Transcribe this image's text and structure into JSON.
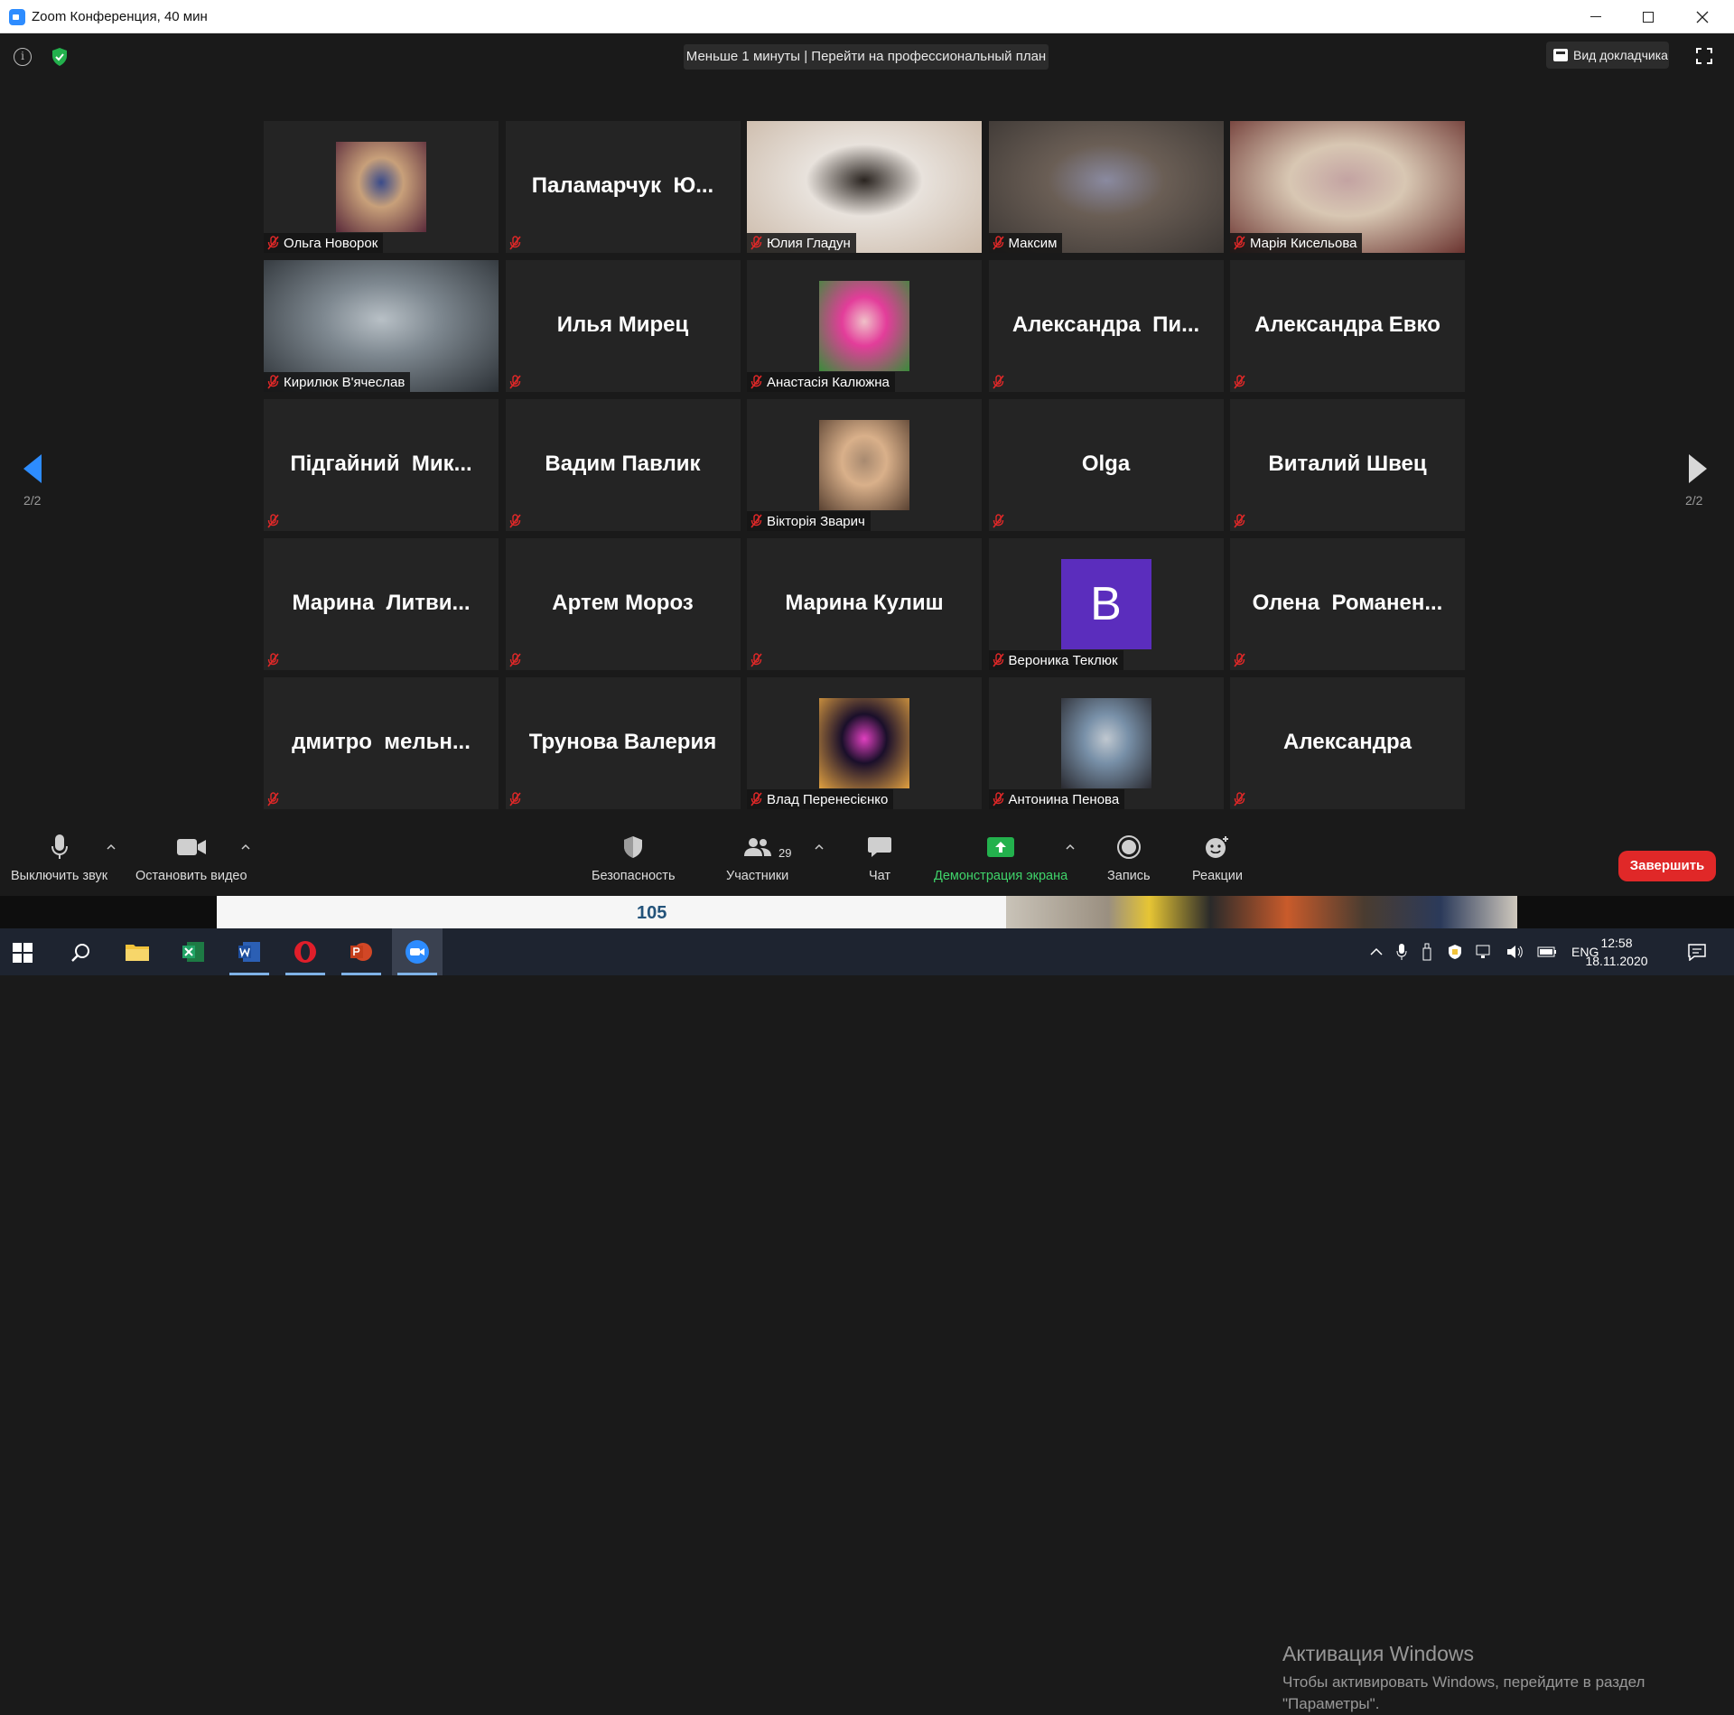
{
  "window": {
    "title": "Zoom Конференция, 40 мин"
  },
  "header": {
    "banner": "Меньше 1 минуты | Перейти на профессиональный план",
    "speaker_view_label": "Вид докладчика"
  },
  "pagination": {
    "left_label": "2/2",
    "right_label": "2/2"
  },
  "participants": [
    {
      "display": "photo",
      "name": "Ольга Новорок",
      "photo_colors": [
        "#c8a07a",
        "#5a2a3a",
        "#3a4b8a"
      ]
    },
    {
      "display": "name",
      "big_name": "Паламарчук  Ю...",
      "name": ""
    },
    {
      "display": "video",
      "name": "Юлия Гладун",
      "photo_colors": [
        "#e8e2dc",
        "#cbb9a8",
        "#2a2420"
      ]
    },
    {
      "display": "video",
      "name": "Максим",
      "photo_colors": [
        "#6a5e55",
        "#3c3734",
        "#8a8aa0"
      ]
    },
    {
      "display": "video",
      "name": "Марія Кисельова",
      "photo_colors": [
        "#d8c7b3",
        "#6b3430",
        "#c3a3a2"
      ]
    },
    {
      "display": "video",
      "name": "Кирилюк В'ячеслав",
      "photo_colors": [
        "#7e8890",
        "#2b3035",
        "#b8c0c6"
      ]
    },
    {
      "display": "name",
      "big_name": "Илья Мирец",
      "name": ""
    },
    {
      "display": "photo",
      "name": "Анастасія Калюжна",
      "photo_colors": [
        "#e33d9a",
        "#3a8c3a",
        "#f0c0c8"
      ]
    },
    {
      "display": "name",
      "big_name": "Александра  Пи...",
      "name": ""
    },
    {
      "display": "name",
      "big_name": "Александра Евко",
      "name": ""
    },
    {
      "display": "name",
      "big_name": "Підгайний  Мик...",
      "name": ""
    },
    {
      "display": "name",
      "big_name": "Вадим Павлик",
      "name": ""
    },
    {
      "display": "photo",
      "name": "Вікторія Зварич",
      "photo_colors": [
        "#d9b08a",
        "#5a4232",
        "#a88a70"
      ]
    },
    {
      "display": "name",
      "big_name": "Olga",
      "name": ""
    },
    {
      "display": "name",
      "big_name": "Виталий Швец",
      "name": ""
    },
    {
      "display": "name",
      "big_name": "Марина  Литви...",
      "name": ""
    },
    {
      "display": "name",
      "big_name": "Артем Мороз",
      "name": ""
    },
    {
      "display": "name",
      "big_name": "Марина Кулиш",
      "name": ""
    },
    {
      "display": "letter",
      "letter": "В",
      "name": "Вероника Теклюк"
    },
    {
      "display": "name",
      "big_name": "Олена  Романен...",
      "name": ""
    },
    {
      "display": "name",
      "big_name": "дмитро  мельн...",
      "name": ""
    },
    {
      "display": "name",
      "big_name": "Трунова Валерия",
      "name": ""
    },
    {
      "display": "photo",
      "name": "Влад Перенесієнко",
      "photo_colors": [
        "#1a0f2a",
        "#e0a040",
        "#e040c0"
      ]
    },
    {
      "display": "photo",
      "name": "Антонина Пенова",
      "photo_colors": [
        "#7890a8",
        "#2a2a30",
        "#c0c8d0"
      ]
    },
    {
      "display": "name",
      "big_name": "Александра",
      "name": ""
    }
  ],
  "toolbar": {
    "mute_label": "Выключить звук",
    "video_label": "Остановить видео",
    "security_label": "Безопасность",
    "participants_label": "Участники",
    "participants_count": "29",
    "chat_label": "Чат",
    "share_label": "Демонстрация экрана",
    "record_label": "Запись",
    "reactions_label": "Реакции",
    "end_label": "Завершить"
  },
  "windows_activation": {
    "title": "Активация Windows",
    "line1": "Чтобы активировать Windows, перейдите в раздел",
    "line2": "\"Параметры\"."
  },
  "background_slide": {
    "page_number": "105"
  },
  "taskbar": {
    "language": "ENG",
    "time": "12:58",
    "date": "18.11.2020"
  },
  "colors": {
    "accent": "#2d8cff",
    "share_green": "#3fd36a",
    "end_red": "#e02828",
    "mute_red": "#e02828"
  }
}
